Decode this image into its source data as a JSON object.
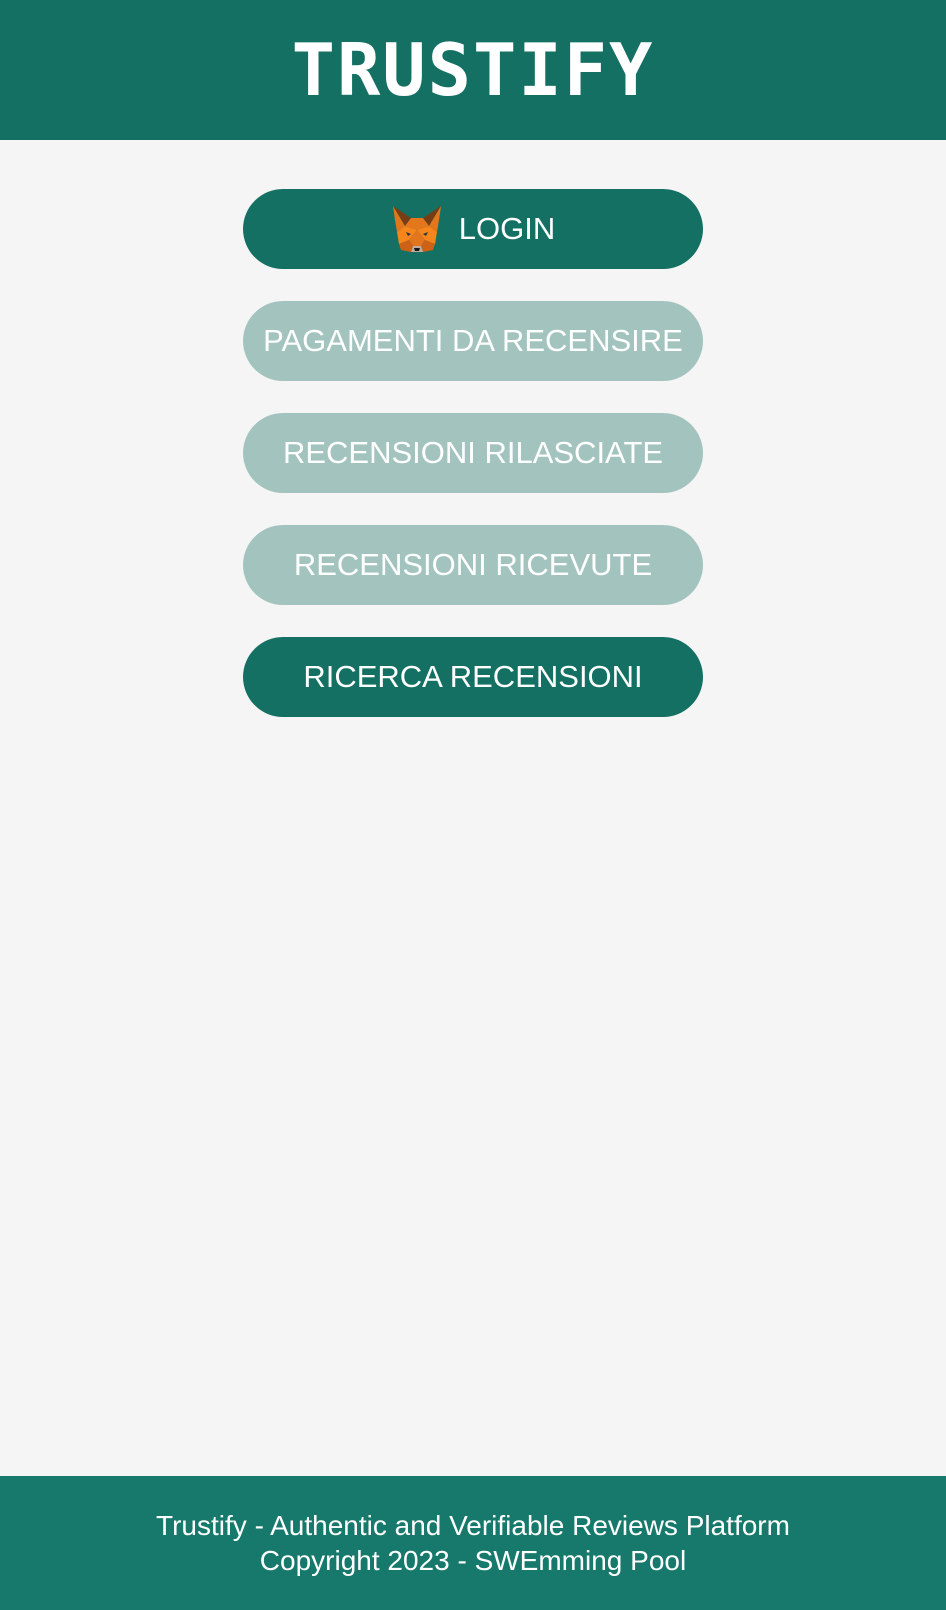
{
  "header": {
    "title": "TRUSTIFY"
  },
  "menu": {
    "login_label": "LOGIN",
    "login_icon": "metamask-fox-icon",
    "payments_label": "PAGAMENTI DA RECENSIRE",
    "given_reviews_label": "RECENSIONI RILASCIATE",
    "received_reviews_label": "RECENSIONI RICEVUTE",
    "search_reviews_label": "RICERCA RECENSIONI"
  },
  "footer": {
    "line1": "Trustify - Authentic and Verifiable Reviews Platform",
    "line2": "Copyright 2023 - SWEmming Pool"
  },
  "colors": {
    "primary": "#137063",
    "muted_button": "#a3c4be",
    "background": "#f5f5f5",
    "footer": "#16796b",
    "text_on_primary": "#ffffff"
  }
}
